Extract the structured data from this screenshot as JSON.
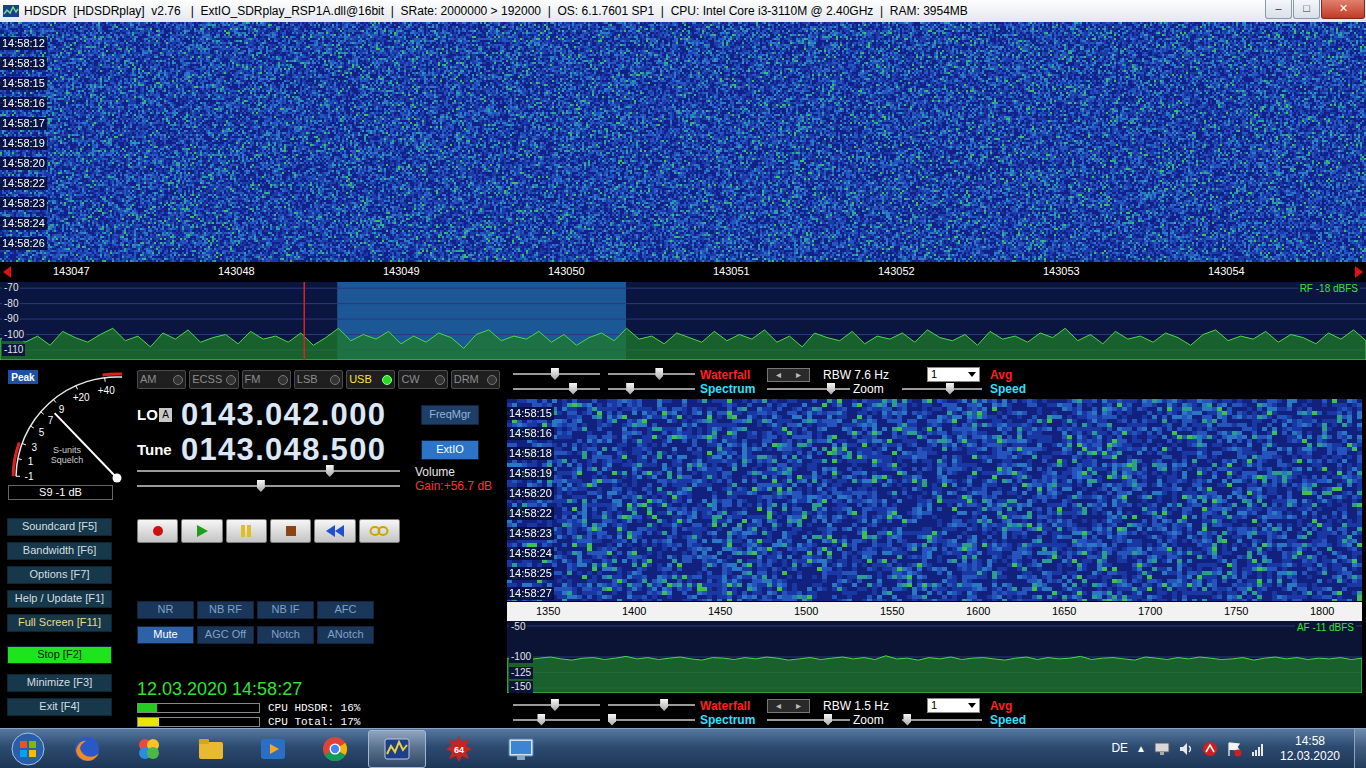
{
  "window": {
    "title": "HDSDR  [HDSDRplay]  v2.76   |  ExtIO_SDRplay_RSP1A.dll@16bit  |  SRate: 2000000 > 192000  |  OS: 6.1.7601 SP1  |  CPU: Intel Core i3-3110M @ 2.40GHz  |  RAM: 3954MB",
    "buttons": [
      "–",
      "□",
      "✕"
    ]
  },
  "rf_waterfall": {
    "times": [
      "14:58:12",
      "14:58:13",
      "14:58:15",
      "14:58:16",
      "14:58:17",
      "14:58:19",
      "14:58:20",
      "14:58:22",
      "14:58:23",
      "14:58:24",
      "14:58:26"
    ]
  },
  "rf_scale": {
    "labels": [
      "143047",
      "143048",
      "143049",
      "143050",
      "143051",
      "143052",
      "143053",
      "143054"
    ]
  },
  "rf_spectrum": {
    "y_labels": [
      "-70",
      "-80",
      "-90",
      "-100",
      "-110"
    ],
    "reading": "RF -18 dBFS",
    "min_db": -116.5,
    "max_db": -66,
    "start_khz": 143046.576,
    "span_khz": 8.279,
    "passband": {
      "low_khz": 143048.62,
      "high_khz": 143050.37
    },
    "tune_khz": 143048.42,
    "values": [
      -103,
      -99,
      -105,
      -101,
      -107,
      -98,
      -102,
      -105,
      -100,
      -96,
      -104,
      -101,
      -108,
      -99,
      -103,
      -97,
      -105,
      -102,
      -100,
      -106,
      -98,
      -103,
      -101,
      -105,
      -99,
      -107,
      -102,
      -96,
      -104,
      -100,
      -103,
      -98,
      -106,
      -101,
      -105,
      -99,
      -102,
      -109,
      -100,
      -97,
      -104,
      -101,
      -103,
      -98,
      -105,
      -100,
      -107,
      -102,
      -99,
      -104,
      -96,
      -103,
      -101,
      -106,
      -99,
      -102,
      -105,
      -98,
      -104,
      -100,
      -103,
      -97,
      -105,
      -101,
      -108,
      -99,
      -102,
      -104,
      -98,
      -106,
      -101,
      -103,
      -99,
      -105,
      -97,
      -102,
      -104,
      -100,
      -107,
      -98,
      -103,
      -101,
      -105,
      -99,
      -102,
      -96,
      -104,
      -100,
      -106,
      -98,
      -103,
      -101,
      -105,
      -99,
      -102,
      -107,
      -100,
      -97,
      -104,
      -101,
      -103,
      -98,
      -105,
      -100,
      -102,
      -106,
      -99,
      -103,
      -97,
      -104
    ]
  },
  "s_meter": {
    "peak": "Peak",
    "scale": [
      "-1",
      "1",
      "3",
      "5",
      "7",
      "9",
      "+20",
      "+40"
    ],
    "caption": [
      "S-units",
      "Squelch"
    ],
    "reading": "S9 -1 dB",
    "level": 0.48
  },
  "side_buttons": [
    {
      "label": "Soundcard [F5]",
      "kind": "normal"
    },
    {
      "label": "Bandwidth [F6]",
      "kind": "normal"
    },
    {
      "label": "Options [F7]",
      "kind": "normal"
    },
    {
      "label": "Help / Update [F1]",
      "kind": "normal"
    },
    {
      "label": "Full Screen [F11]",
      "kind": "accent"
    },
    {
      "label": "Stop [F2]",
      "kind": "run"
    },
    {
      "label": "Minimize [F3]",
      "kind": "normal"
    },
    {
      "label": "Exit [F4]",
      "kind": "normal"
    }
  ],
  "modes": [
    {
      "label": "AM",
      "selected": false
    },
    {
      "label": "ECSS",
      "selected": false
    },
    {
      "label": "FM",
      "selected": false
    },
    {
      "label": "LSB",
      "selected": false
    },
    {
      "label": "USB",
      "selected": true
    },
    {
      "label": "CW",
      "selected": false
    },
    {
      "label": "DRM",
      "selected": false
    }
  ],
  "lo": {
    "label": "LO",
    "bank": "A",
    "frequency": "0143.042.000",
    "button": "FreqMgr"
  },
  "tune": {
    "label": "Tune",
    "frequency": "0143.048.500",
    "button": "ExtIO"
  },
  "tuning_sliders": [
    {
      "level": 0.74
    },
    {
      "level": 0.47
    }
  ],
  "volume": {
    "label": "Volume",
    "gain": "Gain:+56.7 dB"
  },
  "transport": [
    {
      "kind": "record"
    },
    {
      "kind": "play"
    },
    {
      "kind": "pause"
    },
    {
      "kind": "stop"
    },
    {
      "kind": "rewind"
    },
    {
      "kind": "loop"
    }
  ],
  "dsp_buttons": [
    {
      "label": "NR",
      "on": false
    },
    {
      "label": "NB RF",
      "on": false
    },
    {
      "label": "NB IF",
      "on": false
    },
    {
      "label": "AFC",
      "on": false
    },
    {
      "label": "Mute",
      "on": true
    },
    {
      "label": "AGC Off",
      "on": false
    },
    {
      "label": "Notch",
      "on": false
    },
    {
      "label": "ANotch",
      "on": false
    }
  ],
  "clock": "12.03.2020 14:58:27",
  "cpu": [
    {
      "label": "CPU HDSDR: 16%",
      "level": 0.16,
      "color": "#22cc22"
    },
    {
      "label": "CPU Total: 17%",
      "level": 0.17,
      "color": "#e6e600"
    }
  ],
  "rf_controls": {
    "waterfall": "Waterfall",
    "arrows": [
      "◂",
      "▸"
    ],
    "rbw": "RBW 7.6 Hz",
    "avg_value": "1",
    "avg": "Avg",
    "spectrum": "Spectrum",
    "zoom": "Zoom",
    "speed": "Speed",
    "sliders": [
      {
        "level": 0.48
      },
      {
        "level": 0.6
      },
      {
        "level": 0.71
      },
      {
        "level": 0.23
      },
      {
        "level": 0.8
      },
      {
        "level": 0.61
      }
    ]
  },
  "af_waterfall": {
    "times": [
      "14:58:15",
      "14:58:16",
      "14:58:18",
      "14:58:19",
      "14:58:20",
      "14:58:22",
      "14:58:23",
      "14:58:24",
      "14:58:25",
      "14:58:27"
    ]
  },
  "af_scale": {
    "labels": [
      "1350",
      "1400",
      "1450",
      "1500",
      "1550",
      "1600",
      "1650",
      "1700",
      "1750",
      "1800"
    ]
  },
  "af_spectrum": {
    "y_labels": [
      "-50",
      "-100",
      "-125",
      "-150"
    ],
    "reading": "AF -11 dBFS",
    "min_db": -158,
    "max_db": -42,
    "values": [
      -103,
      -101,
      -104,
      -102,
      -100,
      -103,
      -105,
      -102,
      -101,
      -104,
      -102,
      -99,
      -103,
      -101,
      -104,
      -102,
      -100,
      -103,
      -105,
      -101,
      -102,
      -104,
      -101,
      -103,
      -100,
      -102,
      -105,
      -103,
      -101,
      -104,
      -102,
      -100,
      -103,
      -101,
      -104,
      -98,
      -103,
      -102,
      -105,
      -101,
      -103,
      -100,
      -104,
      -102,
      -101,
      -103,
      -105,
      -102,
      -100,
      -104,
      -101,
      -103,
      -102,
      -99,
      -104,
      -102,
      -101,
      -103,
      -105,
      -100,
      -102,
      -104,
      -101,
      -103,
      -100,
      -102,
      -104,
      -103,
      -101,
      -105,
      -102,
      -100,
      -103,
      -101,
      -104,
      -102,
      -103,
      -101,
      -104,
      -102
    ]
  },
  "af_controls": {
    "waterfall": "Waterfall",
    "arrows": [
      "◂",
      "▸"
    ],
    "rbw": "RBW 1.5 Hz",
    "avg_value": "1",
    "avg": "Avg",
    "spectrum": "Spectrum",
    "zoom": "Zoom",
    "speed": "Speed",
    "sliders": [
      {
        "level": 0.48
      },
      {
        "level": 0.66
      },
      {
        "level": 0.31
      },
      {
        "level": 0.0
      },
      {
        "level": 0.76
      },
      {
        "level": 0.02
      }
    ]
  },
  "taskbar": {
    "apps": [
      {
        "kind": "firefox",
        "selected": false
      },
      {
        "kind": "photos",
        "selected": false
      },
      {
        "kind": "explorer",
        "selected": false
      },
      {
        "kind": "media",
        "selected": false
      },
      {
        "kind": "chrome",
        "selected": false
      },
      {
        "kind": "hdsdr",
        "selected": true
      },
      {
        "kind": "counter",
        "badge": "64",
        "selected": false
      },
      {
        "kind": "screen",
        "selected": false
      }
    ],
    "language": "DE",
    "tray_arrow": "▲",
    "tray_icons": [
      {
        "kind": "monitor"
      },
      {
        "kind": "speaker"
      },
      {
        "kind": "antivirus"
      },
      {
        "kind": "flag"
      },
      {
        "kind": "network"
      }
    ],
    "time": "14:58",
    "date": "12.03.2020"
  }
}
